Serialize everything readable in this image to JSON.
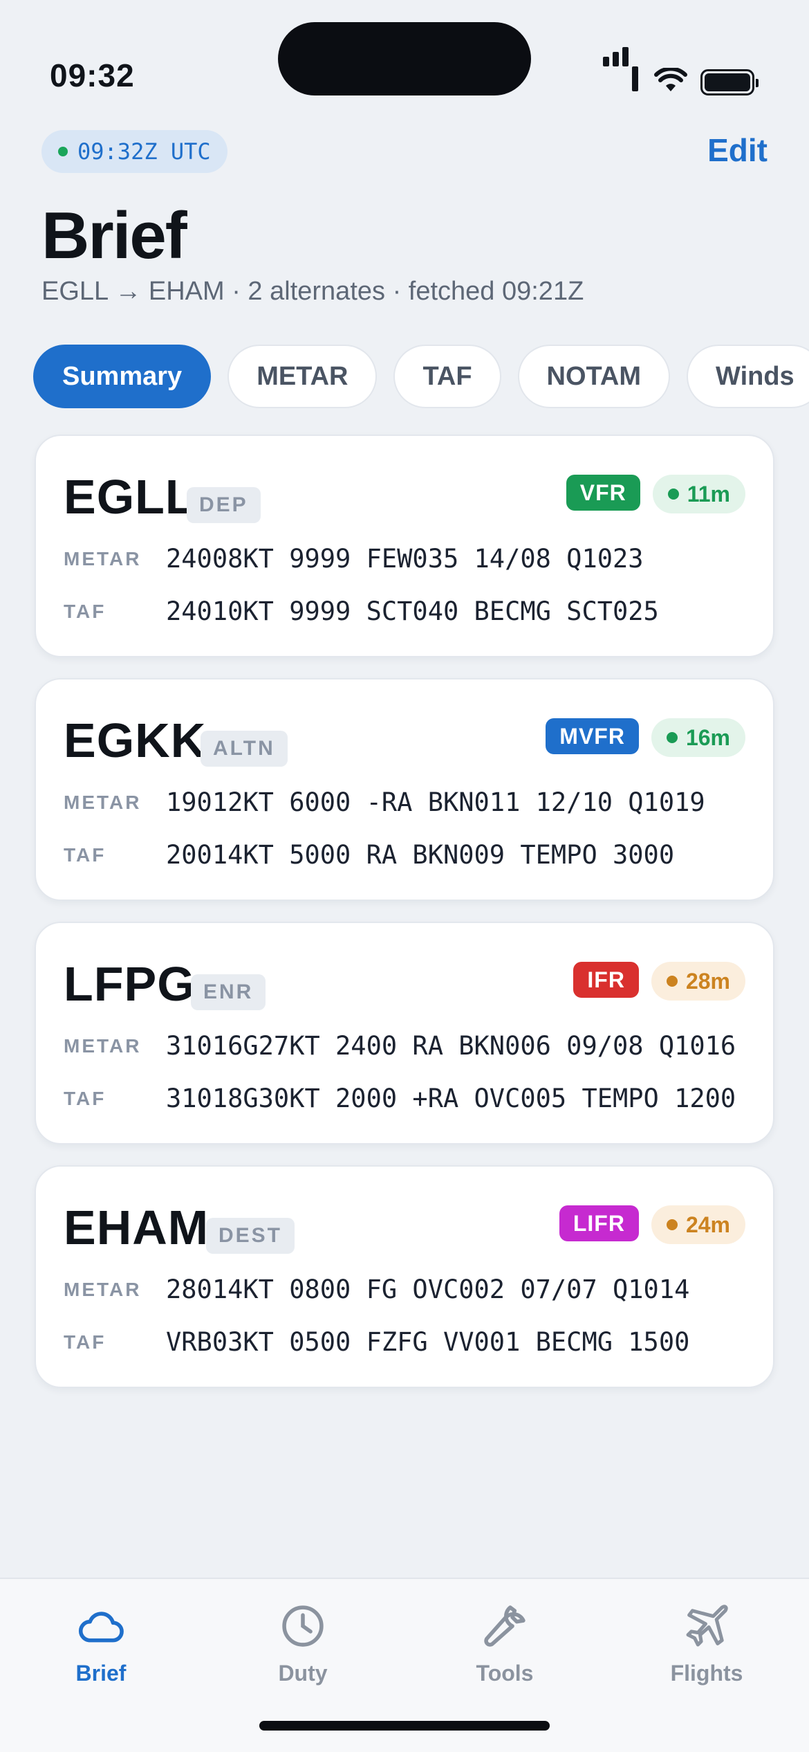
{
  "status_bar": {
    "time": "09:32"
  },
  "header": {
    "utc_clock": "09:32Z UTC",
    "edit_label": "Edit",
    "title": "Brief",
    "subtitle": "EGLL → EHAM · 2 alternates · fetched 09:21Z"
  },
  "tabs": [
    {
      "label": "Summary",
      "active": true
    },
    {
      "label": "METAR",
      "active": false
    },
    {
      "label": "TAF",
      "active": false
    },
    {
      "label": "NOTAM",
      "active": false
    },
    {
      "label": "Winds",
      "active": false
    }
  ],
  "row_labels": {
    "metar": "METAR",
    "taf": "TAF"
  },
  "stations": [
    {
      "icao": "EGLL",
      "role": "DEP",
      "category": "VFR",
      "category_color": "#1a9b55",
      "age": "11m",
      "age_status": "fresh",
      "metar": "24008KT 9999 FEW035 14/08 Q1023",
      "taf": "24010KT 9999 SCT040 BECMG SCT025"
    },
    {
      "icao": "EGKK",
      "role": "ALTN",
      "category": "MVFR",
      "category_color": "#1f6fcb",
      "age": "16m",
      "age_status": "fresh",
      "metar": "19012KT 6000 -RA BKN011 12/10 Q1019",
      "taf": "20014KT 5000 RA BKN009 TEMPO 3000"
    },
    {
      "icao": "LFPG",
      "role": "ENR",
      "category": "IFR",
      "category_color": "#d9302e",
      "age": "28m",
      "age_status": "stale",
      "metar": "31016G27KT 2400 RA BKN006 09/08 Q1016",
      "taf": "31018G30KT 2000 +RA OVC005 TEMPO 1200"
    },
    {
      "icao": "EHAM",
      "role": "DEST",
      "category": "LIFR",
      "category_color": "#c62ad0",
      "age": "24m",
      "age_status": "stale",
      "metar": "28014KT 0800 FG OVC002 07/07 Q1014",
      "taf": "VRB03KT 0500 FZFG VV001 BECMG 1500"
    }
  ],
  "tab_bar": [
    {
      "label": "Brief",
      "icon": "cloud-icon",
      "active": true
    },
    {
      "label": "Duty",
      "icon": "clock-icon",
      "active": false
    },
    {
      "label": "Tools",
      "icon": "wrench-icon",
      "active": false
    },
    {
      "label": "Flights",
      "icon": "plane-icon",
      "active": false
    }
  ],
  "colors": {
    "accent": "#1f6fcb",
    "background": "#eef1f5"
  }
}
